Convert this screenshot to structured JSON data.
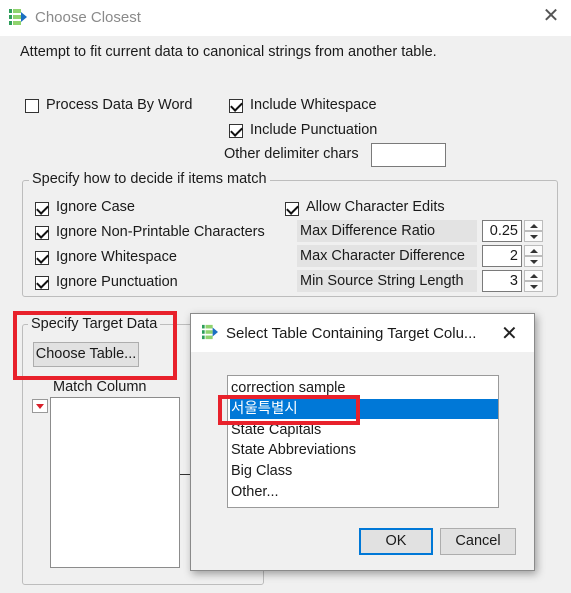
{
  "window": {
    "title": "Choose Closest",
    "close_glyph": "✕"
  },
  "description": "Attempt to fit current data to canonical strings from another table.",
  "options": {
    "process_by_word": {
      "label": "Process Data By Word",
      "checked": false
    },
    "include_whitespace": {
      "label": "Include Whitespace",
      "checked": true
    },
    "include_punctuation": {
      "label": "Include Punctuation",
      "checked": true
    },
    "other_delimiter": {
      "label": "Other delimiter chars",
      "value": ""
    }
  },
  "match_group": {
    "title": "Specify how to decide if items match",
    "ignore_case": {
      "label": "Ignore Case",
      "checked": true
    },
    "ignore_nonprintable": {
      "label": "Ignore Non-Printable Characters",
      "checked": true
    },
    "ignore_whitespace": {
      "label": "Ignore Whitespace",
      "checked": true
    },
    "ignore_punctuation": {
      "label": "Ignore Punctuation",
      "checked": true
    },
    "allow_char_edits": {
      "label": "Allow Character Edits",
      "checked": true
    },
    "max_diff_ratio": {
      "label": "Max Difference Ratio",
      "value": "0.25"
    },
    "max_char_diff": {
      "label": "Max Character Difference",
      "value": "2"
    },
    "min_source_len": {
      "label": "Min Source String Length",
      "value": "3"
    }
  },
  "target_group": {
    "title": "Specify Target Data",
    "choose_table_label": "Choose Table...",
    "match_column_label": "Match Column"
  },
  "popup": {
    "title": "Select Table Containing Target Colu...",
    "close_glyph": "✕",
    "tables": [
      "correction sample",
      "서울특별시",
      "State Capitals",
      "State Abbreviations",
      "Big Class",
      "Other..."
    ],
    "selected_index": 1,
    "ok_label": "OK",
    "cancel_label": "Cancel"
  },
  "colors": {
    "highlight": "#e8212b",
    "selection": "#0078d7",
    "accent_icon": "#2e9e5b"
  },
  "icons": [
    "jmp-app-icon",
    "close-icon",
    "checkbox-icon",
    "spin-up-icon",
    "spin-down-icon",
    "dropdown-red-triangle-icon"
  ]
}
